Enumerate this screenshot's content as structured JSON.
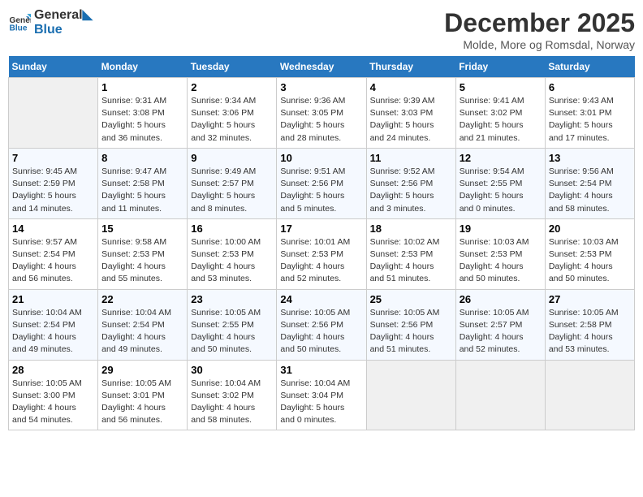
{
  "header": {
    "logo_line1": "General",
    "logo_line2": "Blue",
    "title": "December 2025",
    "subtitle": "Molde, More og Romsdal, Norway"
  },
  "weekdays": [
    "Sunday",
    "Monday",
    "Tuesday",
    "Wednesday",
    "Thursday",
    "Friday",
    "Saturday"
  ],
  "weeks": [
    [
      {
        "day": "",
        "info": ""
      },
      {
        "day": "1",
        "info": "Sunrise: 9:31 AM\nSunset: 3:08 PM\nDaylight: 5 hours\nand 36 minutes."
      },
      {
        "day": "2",
        "info": "Sunrise: 9:34 AM\nSunset: 3:06 PM\nDaylight: 5 hours\nand 32 minutes."
      },
      {
        "day": "3",
        "info": "Sunrise: 9:36 AM\nSunset: 3:05 PM\nDaylight: 5 hours\nand 28 minutes."
      },
      {
        "day": "4",
        "info": "Sunrise: 9:39 AM\nSunset: 3:03 PM\nDaylight: 5 hours\nand 24 minutes."
      },
      {
        "day": "5",
        "info": "Sunrise: 9:41 AM\nSunset: 3:02 PM\nDaylight: 5 hours\nand 21 minutes."
      },
      {
        "day": "6",
        "info": "Sunrise: 9:43 AM\nSunset: 3:01 PM\nDaylight: 5 hours\nand 17 minutes."
      }
    ],
    [
      {
        "day": "7",
        "info": "Sunrise: 9:45 AM\nSunset: 2:59 PM\nDaylight: 5 hours\nand 14 minutes."
      },
      {
        "day": "8",
        "info": "Sunrise: 9:47 AM\nSunset: 2:58 PM\nDaylight: 5 hours\nand 11 minutes."
      },
      {
        "day": "9",
        "info": "Sunrise: 9:49 AM\nSunset: 2:57 PM\nDaylight: 5 hours\nand 8 minutes."
      },
      {
        "day": "10",
        "info": "Sunrise: 9:51 AM\nSunset: 2:56 PM\nDaylight: 5 hours\nand 5 minutes."
      },
      {
        "day": "11",
        "info": "Sunrise: 9:52 AM\nSunset: 2:56 PM\nDaylight: 5 hours\nand 3 minutes."
      },
      {
        "day": "12",
        "info": "Sunrise: 9:54 AM\nSunset: 2:55 PM\nDaylight: 5 hours\nand 0 minutes."
      },
      {
        "day": "13",
        "info": "Sunrise: 9:56 AM\nSunset: 2:54 PM\nDaylight: 4 hours\nand 58 minutes."
      }
    ],
    [
      {
        "day": "14",
        "info": "Sunrise: 9:57 AM\nSunset: 2:54 PM\nDaylight: 4 hours\nand 56 minutes."
      },
      {
        "day": "15",
        "info": "Sunrise: 9:58 AM\nSunset: 2:53 PM\nDaylight: 4 hours\nand 55 minutes."
      },
      {
        "day": "16",
        "info": "Sunrise: 10:00 AM\nSunset: 2:53 PM\nDaylight: 4 hours\nand 53 minutes."
      },
      {
        "day": "17",
        "info": "Sunrise: 10:01 AM\nSunset: 2:53 PM\nDaylight: 4 hours\nand 52 minutes."
      },
      {
        "day": "18",
        "info": "Sunrise: 10:02 AM\nSunset: 2:53 PM\nDaylight: 4 hours\nand 51 minutes."
      },
      {
        "day": "19",
        "info": "Sunrise: 10:03 AM\nSunset: 2:53 PM\nDaylight: 4 hours\nand 50 minutes."
      },
      {
        "day": "20",
        "info": "Sunrise: 10:03 AM\nSunset: 2:53 PM\nDaylight: 4 hours\nand 50 minutes."
      }
    ],
    [
      {
        "day": "21",
        "info": "Sunrise: 10:04 AM\nSunset: 2:54 PM\nDaylight: 4 hours\nand 49 minutes."
      },
      {
        "day": "22",
        "info": "Sunrise: 10:04 AM\nSunset: 2:54 PM\nDaylight: 4 hours\nand 49 minutes."
      },
      {
        "day": "23",
        "info": "Sunrise: 10:05 AM\nSunset: 2:55 PM\nDaylight: 4 hours\nand 50 minutes."
      },
      {
        "day": "24",
        "info": "Sunrise: 10:05 AM\nSunset: 2:56 PM\nDaylight: 4 hours\nand 50 minutes."
      },
      {
        "day": "25",
        "info": "Sunrise: 10:05 AM\nSunset: 2:56 PM\nDaylight: 4 hours\nand 51 minutes."
      },
      {
        "day": "26",
        "info": "Sunrise: 10:05 AM\nSunset: 2:57 PM\nDaylight: 4 hours\nand 52 minutes."
      },
      {
        "day": "27",
        "info": "Sunrise: 10:05 AM\nSunset: 2:58 PM\nDaylight: 4 hours\nand 53 minutes."
      }
    ],
    [
      {
        "day": "28",
        "info": "Sunrise: 10:05 AM\nSunset: 3:00 PM\nDaylight: 4 hours\nand 54 minutes."
      },
      {
        "day": "29",
        "info": "Sunrise: 10:05 AM\nSunset: 3:01 PM\nDaylight: 4 hours\nand 56 minutes."
      },
      {
        "day": "30",
        "info": "Sunrise: 10:04 AM\nSunset: 3:02 PM\nDaylight: 4 hours\nand 58 minutes."
      },
      {
        "day": "31",
        "info": "Sunrise: 10:04 AM\nSunset: 3:04 PM\nDaylight: 5 hours\nand 0 minutes."
      },
      {
        "day": "",
        "info": ""
      },
      {
        "day": "",
        "info": ""
      },
      {
        "day": "",
        "info": ""
      }
    ]
  ]
}
